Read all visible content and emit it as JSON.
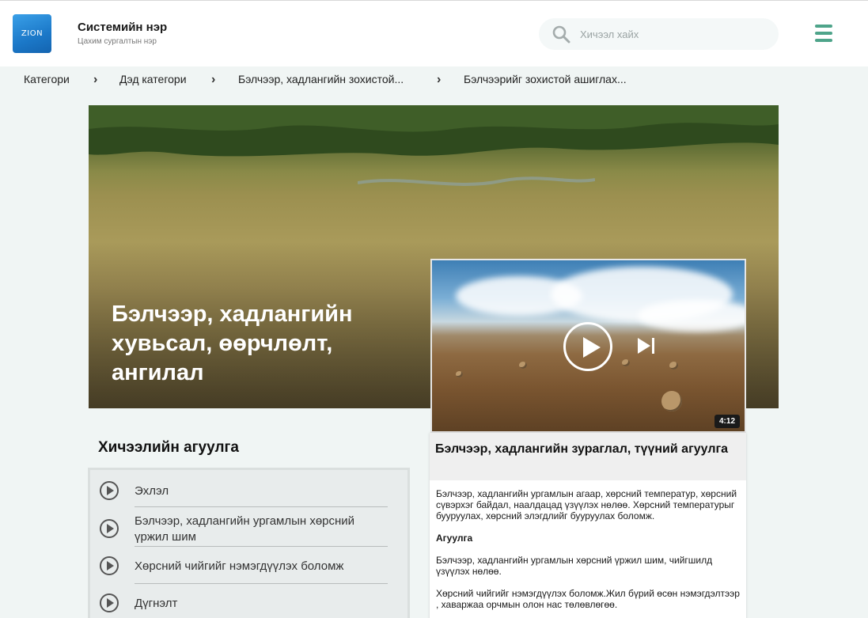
{
  "header": {
    "logo_text": "ZION",
    "system_name": "Системийн нэр",
    "system_subtitle": "Цахим сургалтын нэр",
    "search_placeholder": "Хичээл хайх"
  },
  "breadcrumb": [
    "Категори",
    "Дэд категори",
    "Бэлчээр, хадлангийн зохистой...",
    "Бэлчээрийг зохистой ашиглах..."
  ],
  "hero": {
    "title": "Бэлчээр, хадлангийн хувьсал, өөрчлөлт, ангилал"
  },
  "video": {
    "duration": "4:12"
  },
  "info": {
    "title": "Бэлчээр, хадлангийн зураглал, түүний агуулга",
    "intro": "Бэлчээр, хадлангийн ургамлын агаар, хөрсний температур, хөрсний сүвэрхэг байдал, наалдацад үзүүлэх нөлөө. Хөрсний температурыг бууруулах, хөрсний элэгдлийг бууруулах боломж.",
    "section_heading": "Агуулга",
    "para1": "Бэлчээр, хадлангийн ургамлын хөрсний үржил шим, чийгшилд үзүүлэх нөлөө.",
    "para2": "Хөрсний чийгийг нэмэгдүүлэх боломж.Жил бүрий өсөн нэмэгдэлтээр , хаваржаа орчмын олон нас төлөвлөгөө."
  },
  "content": {
    "title": "Хичээлийн агуулга",
    "lessons": [
      "Эхлэл",
      "Бэлчээр, хадлангийн ургамлын хөрсний үржил шим",
      "Хөрсний чийгийг нэмэгдүүлэх боломж",
      "Дүгнэлт"
    ]
  },
  "colors": {
    "accent": "#4ea48a",
    "logo": "#1b78c8"
  }
}
